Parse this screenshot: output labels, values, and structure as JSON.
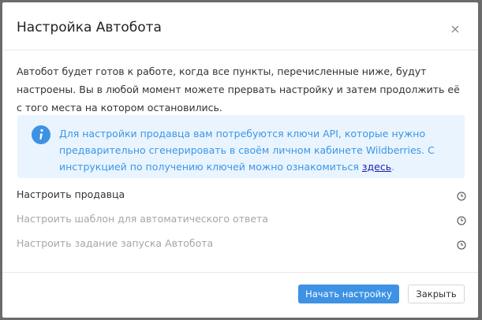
{
  "dialog": {
    "title": "Настройка Автобота",
    "close_icon": "close-icon",
    "intro": "Автобот будет готов к работе, когда все пункты, перечисленные ниже, будут настроены. Вы в любой момент можете прервать настройку и затем продолжить её с того места на котором остановились.",
    "info": {
      "icon": "info-icon",
      "text": "Для настройки продавца вам потребуются ключи API, которые нужно предварительно сгенерировать в своём личном кабинете Wildberries. С инструкцией по получению ключей можно ознакомиться ",
      "link": "здесь",
      "after": "."
    },
    "steps": [
      {
        "label": "Настроить продавца",
        "icon": "clock-icon"
      },
      {
        "label": "Настроить шаблон для автоматического ответа",
        "icon": "clock-icon"
      },
      {
        "label": "Настроить задание запуска Автобота",
        "icon": "clock-icon"
      }
    ],
    "buttons": {
      "start": "Начать настройку",
      "close": "Закрыть"
    }
  },
  "colors": {
    "backdrop": "#6b6b6b",
    "info_background": "#eaf4fe",
    "info_text": "#3a97e6",
    "link": "#1d1dad",
    "primary_button": "#3d92e4",
    "step_active": "#333333",
    "step_inactive": "#a6a6a6"
  }
}
